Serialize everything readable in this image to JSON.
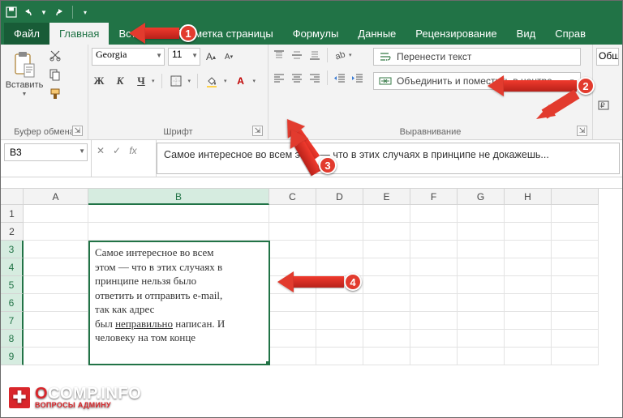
{
  "tabs": {
    "file": "Файл",
    "home": "Главная",
    "insert": "Вставка",
    "layout": "Разметка страницы",
    "formulas": "Формулы",
    "data": "Данные",
    "review": "Рецензирование",
    "view": "Вид",
    "help": "Справ"
  },
  "clipboard": {
    "paste": "Вставить",
    "group": "Буфер обмена"
  },
  "font": {
    "name": "Georgia",
    "size": "11",
    "group": "Шрифт"
  },
  "align": {
    "wrap": "Перенести текст",
    "merge": "Объединить и поместить в центре",
    "group": "Выравнивание"
  },
  "number_group_hint": "Общ",
  "namebox": "B3",
  "formula_text": "Самое интересное во всем этом — что в этих случаях в принципе не докажешь...",
  "columns": [
    "A",
    "B",
    "C",
    "D",
    "E",
    "F",
    "G",
    "H"
  ],
  "rows": [
    "1",
    "2",
    "3",
    "4",
    "5",
    "6",
    "7",
    "8",
    "9"
  ],
  "merged_cell": {
    "line1": "Самое интересное во всем",
    "line2": "этом — что в этих случаях в",
    "line3": "принципе нельзя было",
    "line4": "ответить и отправить e-mail,",
    "line5": "так как адрес",
    "line6a": "был ",
    "line6u": "неправильно",
    "line6b": " написан. И",
    "line7": "человеку на том конце"
  },
  "callouts": {
    "c1": "1",
    "c2": "2",
    "c3": "3",
    "c4": "4"
  },
  "watermark": {
    "brand_o": "O",
    "brand_rest": "COMP.INFO",
    "sub": "ВОПРОСЫ АДМИНУ"
  }
}
